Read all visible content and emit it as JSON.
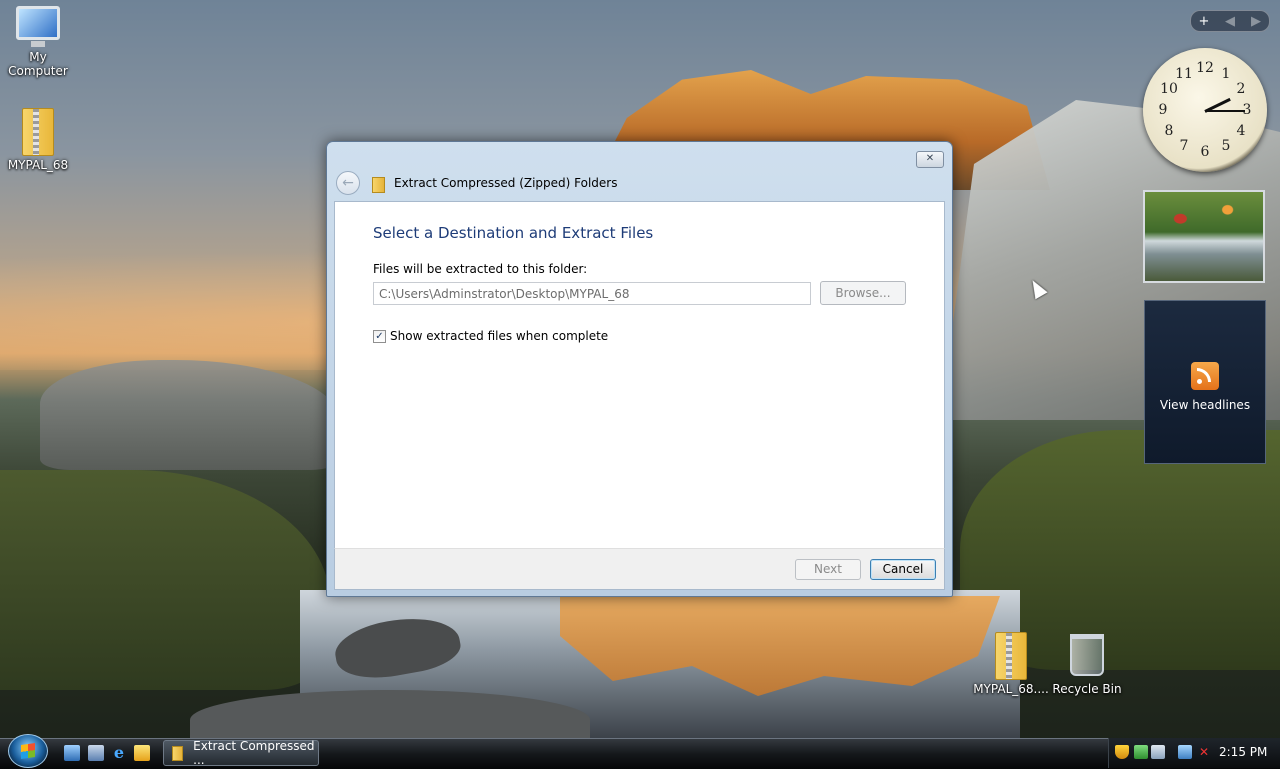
{
  "desktop": {
    "icons": [
      {
        "label": "My Computer"
      },
      {
        "label": "MYPAL_68"
      },
      {
        "label": "MYPAL_68...."
      },
      {
        "label": "Recycle Bin"
      }
    ]
  },
  "sidebar": {
    "controls": {
      "add": "+",
      "prev": "◀",
      "next": "▶"
    },
    "clock": {
      "numbers": [
        "12",
        "1",
        "2",
        "3",
        "4",
        "5",
        "6",
        "7",
        "8",
        "9",
        "10",
        "11"
      ]
    },
    "feed": {
      "label": "View headlines"
    }
  },
  "dialog": {
    "title": "Extract Compressed (Zipped) Folders",
    "close_label": "✕",
    "back_label": "←",
    "heading": "Select a Destination and Extract Files",
    "field_label": "Files will be extracted to this folder:",
    "path_value": "C:\\Users\\Adminstrator\\Desktop\\MYPAL_68",
    "browse_label": "Browse...",
    "checkbox_label": "Show extracted files when complete",
    "checkbox_checked": true,
    "next_label": "Next",
    "cancel_label": "Cancel"
  },
  "taskbar": {
    "task_label": "Extract Compressed ...",
    "time": "2:15 PM"
  }
}
